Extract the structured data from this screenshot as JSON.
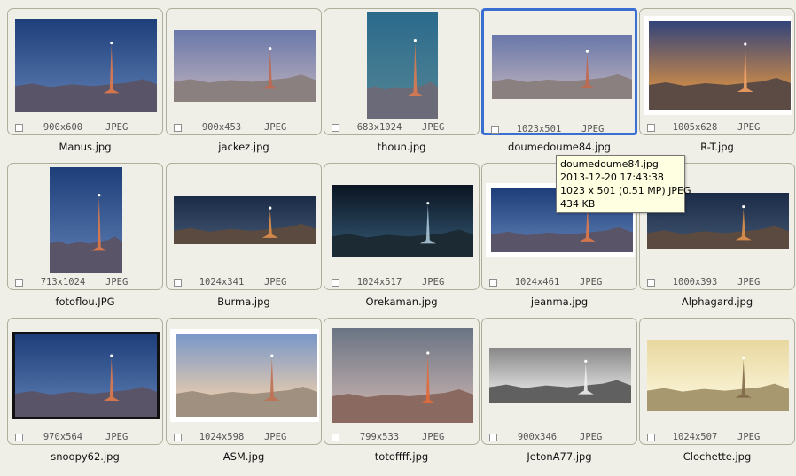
{
  "items": [
    {
      "name": "Manus.jpg",
      "dims": "900x600",
      "format": "JPEG",
      "w": 160,
      "h": 106,
      "style": "blue"
    },
    {
      "name": "jackez.jpg",
      "dims": "900x453",
      "format": "JPEG",
      "w": 160,
      "h": 81,
      "style": "dusk"
    },
    {
      "name": "thoun.jpg",
      "dims": "683x1024",
      "format": "JPEG",
      "w": 80,
      "h": 120,
      "style": "teal"
    },
    {
      "name": "doumedoume84.jpg",
      "dims": "1023x501",
      "format": "JPEG",
      "w": 158,
      "h": 72,
      "style": "dusk",
      "selected": true
    },
    {
      "name": "R-T.jpg",
      "dims": "1005x628",
      "format": "JPEG",
      "w": 160,
      "h": 100,
      "style": "sunset",
      "white": true
    },
    {
      "name": "fotoflou.JPG",
      "dims": "713x1024",
      "format": "JPEG",
      "w": 82,
      "h": 120,
      "style": "blue"
    },
    {
      "name": "Burma.jpg",
      "dims": "1024x341",
      "format": "JPEG",
      "w": 160,
      "h": 54,
      "style": "night"
    },
    {
      "name": "Orekaman.jpg",
      "dims": "1024x517",
      "format": "JPEG",
      "w": 160,
      "h": 81,
      "style": "dark"
    },
    {
      "name": "jeanma.jpg",
      "dims": "1024x461",
      "format": "JPEG",
      "w": 160,
      "h": 72,
      "style": "blue",
      "white": true
    },
    {
      "name": "Alphagard.jpg",
      "dims": "1000x393",
      "format": "JPEG",
      "w": 160,
      "h": 63,
      "style": "night"
    },
    {
      "name": "snoopy62.jpg",
      "dims": "970x564",
      "format": "JPEG",
      "w": 160,
      "h": 93,
      "style": "blue",
      "framed": true
    },
    {
      "name": "ASM.jpg",
      "dims": "1024x598",
      "format": "JPEG",
      "w": 160,
      "h": 93,
      "style": "pastel",
      "white": true
    },
    {
      "name": "totoffff.jpg",
      "dims": "799x533",
      "format": "JPEG",
      "w": 160,
      "h": 107,
      "style": "grey"
    },
    {
      "name": "JetonA77.jpg",
      "dims": "900x346",
      "format": "JPEG",
      "w": 160,
      "h": 62,
      "style": "bw"
    },
    {
      "name": "Clochette.jpg",
      "dims": "1024x507",
      "format": "JPEG",
      "w": 160,
      "h": 80,
      "style": "sepia"
    }
  ],
  "tooltip": {
    "filename": "doumedoume84.jpg",
    "date": "2013-12-20 17:43:38",
    "info": "1023 x 501 (0.51 MP)  JPEG",
    "size": "434 KB"
  },
  "styles": {
    "blue": {
      "sky1": "#1e3e7a",
      "sky2": "#4f6fa6",
      "city": "#5a5468",
      "tower": "#e07a4a"
    },
    "dusk": {
      "sky1": "#6a78aa",
      "sky2": "#a9a3b8",
      "city": "#8a8080",
      "tower": "#c0684c"
    },
    "teal": {
      "sky1": "#2b6a8c",
      "sky2": "#4a7f93",
      "city": "#6a6a78",
      "tower": "#d97a50"
    },
    "sunset": {
      "sky1": "#33447a",
      "sky2": "#c7884a",
      "city": "#5c4a44",
      "tower": "#f0a060"
    },
    "night": {
      "sky1": "#1c2c48",
      "sky2": "#374a66",
      "city": "#5a4a40",
      "tower": "#e0904a"
    },
    "dark": {
      "sky1": "#0b1522",
      "sky2": "#2a4860",
      "city": "#1c2a34",
      "tower": "#a8c4d6"
    },
    "pastel": {
      "sky1": "#7a98c8",
      "sky2": "#e0c8b0",
      "city": "#a09080",
      "tower": "#c07050"
    },
    "grey": {
      "sky1": "#6a7484",
      "sky2": "#b8a8a8",
      "city": "#8a6a60",
      "tower": "#e06a3a"
    },
    "bw": {
      "sky1": "#888888",
      "sky2": "#d8d8d8",
      "city": "#606060",
      "tower": "#f0f0f0"
    },
    "sepia": {
      "sky1": "#e8d8a0",
      "sky2": "#f8f0d0",
      "city": "#a89870",
      "tower": "#806848"
    }
  }
}
